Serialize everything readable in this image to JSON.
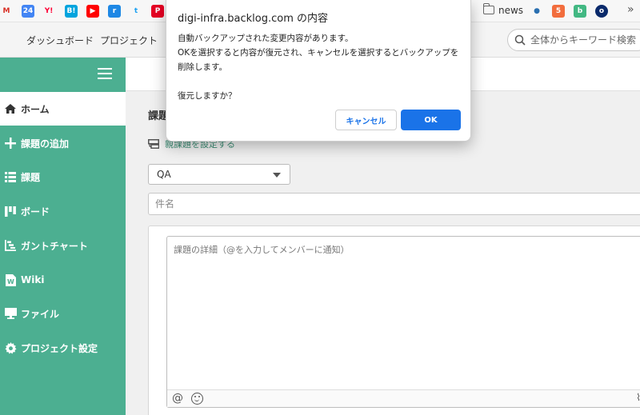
{
  "bookmarks": {
    "icons": [
      {
        "name": "gmail-icon",
        "glyph": "M",
        "color": "#d93025",
        "bg": "transparent"
      },
      {
        "name": "calendar-icon",
        "glyph": "24",
        "color": "#ffffff",
        "bg": "#4285f4"
      },
      {
        "name": "yahoo-icon",
        "glyph": "Y!",
        "color": "#ff0033",
        "bg": "transparent"
      },
      {
        "name": "hatena-icon",
        "glyph": "B!",
        "color": "#ffffff",
        "bg": "#00a4de"
      },
      {
        "name": "youtube-icon",
        "glyph": "▶",
        "color": "#ffffff",
        "bg": "#ff0000"
      },
      {
        "name": "app-icon",
        "glyph": "r",
        "color": "#ffffff",
        "bg": "#1e88e5"
      },
      {
        "name": "twitter-icon",
        "glyph": "t",
        "color": "#1da1f2",
        "bg": "transparent"
      },
      {
        "name": "pinterest-icon",
        "glyph": "P",
        "color": "#ffffff",
        "bg": "#e60023"
      }
    ],
    "news_label": "news",
    "right_icons": [
      {
        "name": "globe-icon",
        "glyph": "●",
        "color": "#2a6fb0",
        "bg": "transparent"
      },
      {
        "name": "s-app-icon",
        "glyph": "5",
        "color": "#ffffff",
        "bg": "#f26d3d"
      },
      {
        "name": "b-app-icon",
        "glyph": "b",
        "color": "#ffffff",
        "bg": "#42b883"
      },
      {
        "name": "circle-app-icon",
        "glyph": "o",
        "color": "#ffffff",
        "bg": "#0a2a6b"
      }
    ],
    "more": "»"
  },
  "topnav": {
    "dashboard": "ダッシュボード",
    "project": "プロジェクト",
    "search_placeholder": "全体からキーワード検索"
  },
  "sidebar": {
    "items": [
      {
        "label": "ホーム",
        "icon": "home-icon"
      },
      {
        "label": "課題の追加",
        "icon": "plus-icon"
      },
      {
        "label": "課題",
        "icon": "list-icon"
      },
      {
        "label": "ボード",
        "icon": "board-icon"
      },
      {
        "label": "ガントチャート",
        "icon": "gantt-icon"
      },
      {
        "label": "Wiki",
        "icon": "wiki-icon"
      },
      {
        "label": "ファイル",
        "icon": "folder-icon"
      },
      {
        "label": "プロジェクト設定",
        "icon": "gear-icon"
      }
    ]
  },
  "main": {
    "heading": "課題",
    "parent_link": "親課題を設定する",
    "issue_type": "QA",
    "subject_placeholder": "件名",
    "description_placeholder": "課題の詳細（@を入力してメンバーに通知）",
    "toolbar_at": "@",
    "toolbar_right": "⌇"
  },
  "dialog": {
    "title": "digi-infra.backlog.com の内容",
    "line1": "自動バックアップされた変更内容があります。",
    "line2": "OKを選択すると内容が復元され、キャンセルを選択するとバックアップを削除します。",
    "line3": "復元しますか？",
    "cancel": "キャンセル",
    "ok": "OK"
  },
  "colors": {
    "sidebar": "#4caf91",
    "accent": "#1a73e8"
  }
}
